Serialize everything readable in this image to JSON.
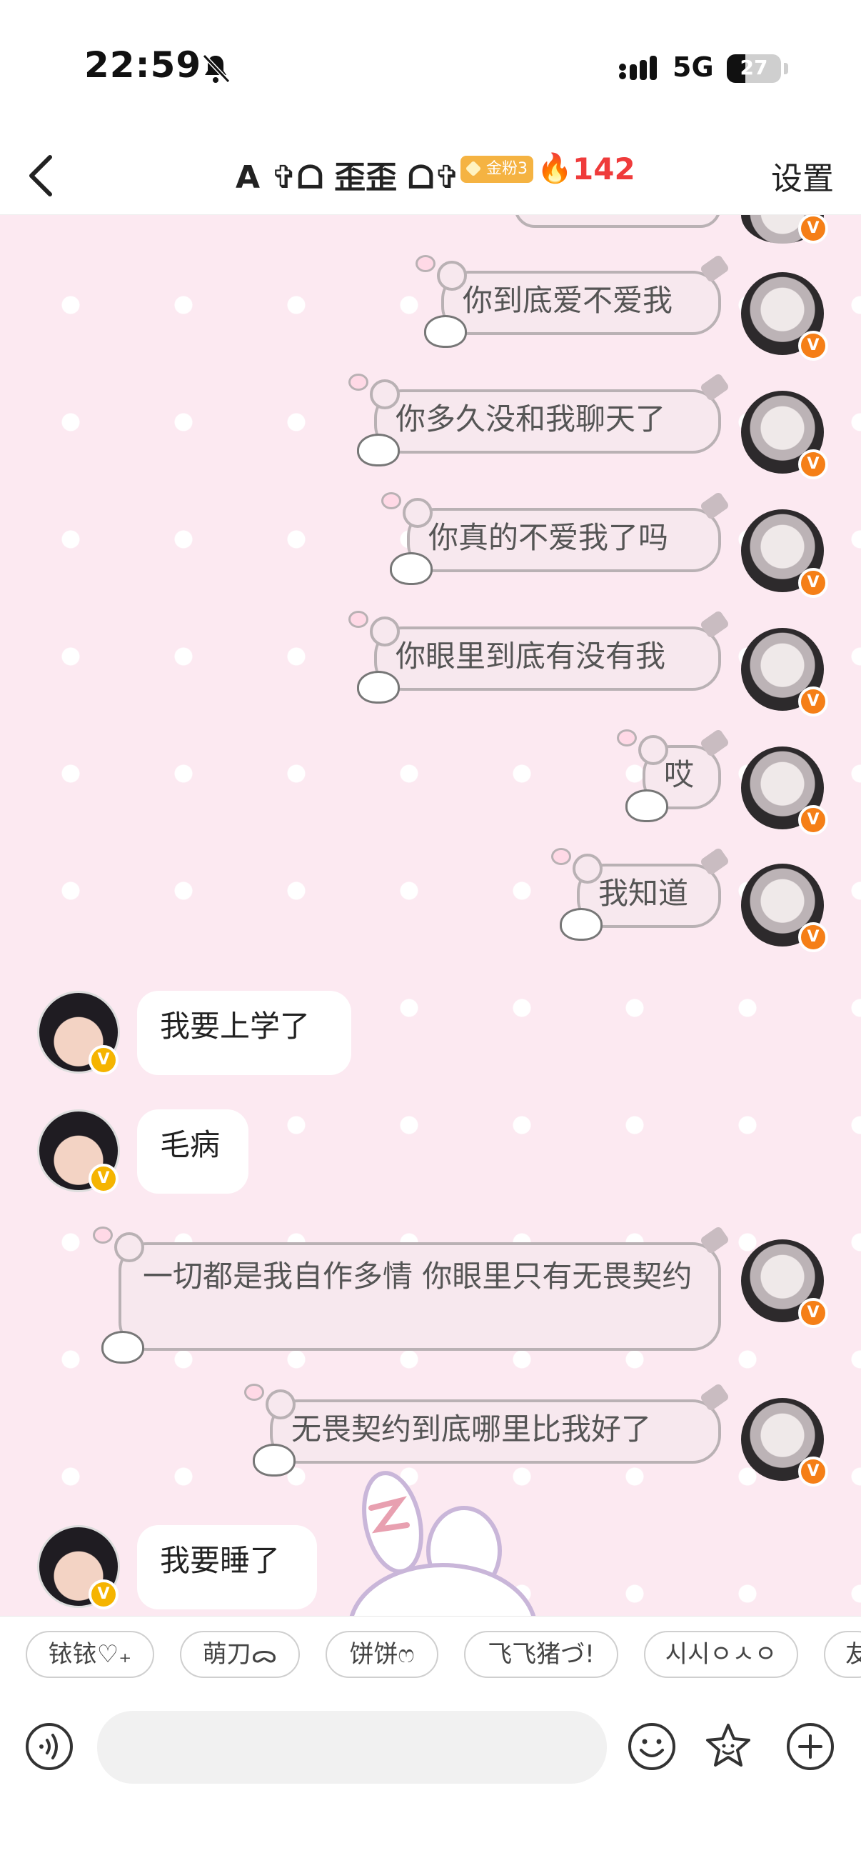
{
  "status_bar": {
    "time": "22:59",
    "network": "5G",
    "battery": "27"
  },
  "header": {
    "title": "A ✞ᗝ 歪歪 ᗝ✞",
    "fan_badge": "金粉3",
    "streak_count": "142",
    "settings_label": "设置"
  },
  "messages": [
    {
      "side": "right",
      "text": "你到底爱不爱我"
    },
    {
      "side": "right",
      "text": "你多久没和我聊天了"
    },
    {
      "side": "right",
      "text": "你真的不爱我了吗"
    },
    {
      "side": "right",
      "text": "你眼里到底有没有我"
    },
    {
      "side": "right",
      "text": "哎"
    },
    {
      "side": "right",
      "text": "我知道"
    },
    {
      "side": "left",
      "text": "我要上学了"
    },
    {
      "side": "left",
      "text": "毛病"
    },
    {
      "side": "right",
      "text": "一切都是我自作多情 你眼里只有无畏契约"
    },
    {
      "side": "right",
      "text": "无畏契约到底哪里比我好了"
    },
    {
      "side": "left",
      "text": "我要睡了"
    }
  ],
  "quick_replies": [
    "铱铱♡₊",
    "萌刀ᯅ",
    "饼饼ෆ",
    "飞飞猪づ!",
    "시시ㅇㅅㅇ",
    "友"
  ],
  "input": {
    "placeholder": ""
  },
  "icons": {
    "voice": "voice-icon",
    "emoji": "emoji-icon",
    "sticker": "sticker-icon",
    "add": "add-icon"
  },
  "colors": {
    "chat_bg": "#fce9f1",
    "verified_orange": "#f57f17",
    "verified_yellow": "#f5b400",
    "streak_red": "#ef3b3b"
  }
}
